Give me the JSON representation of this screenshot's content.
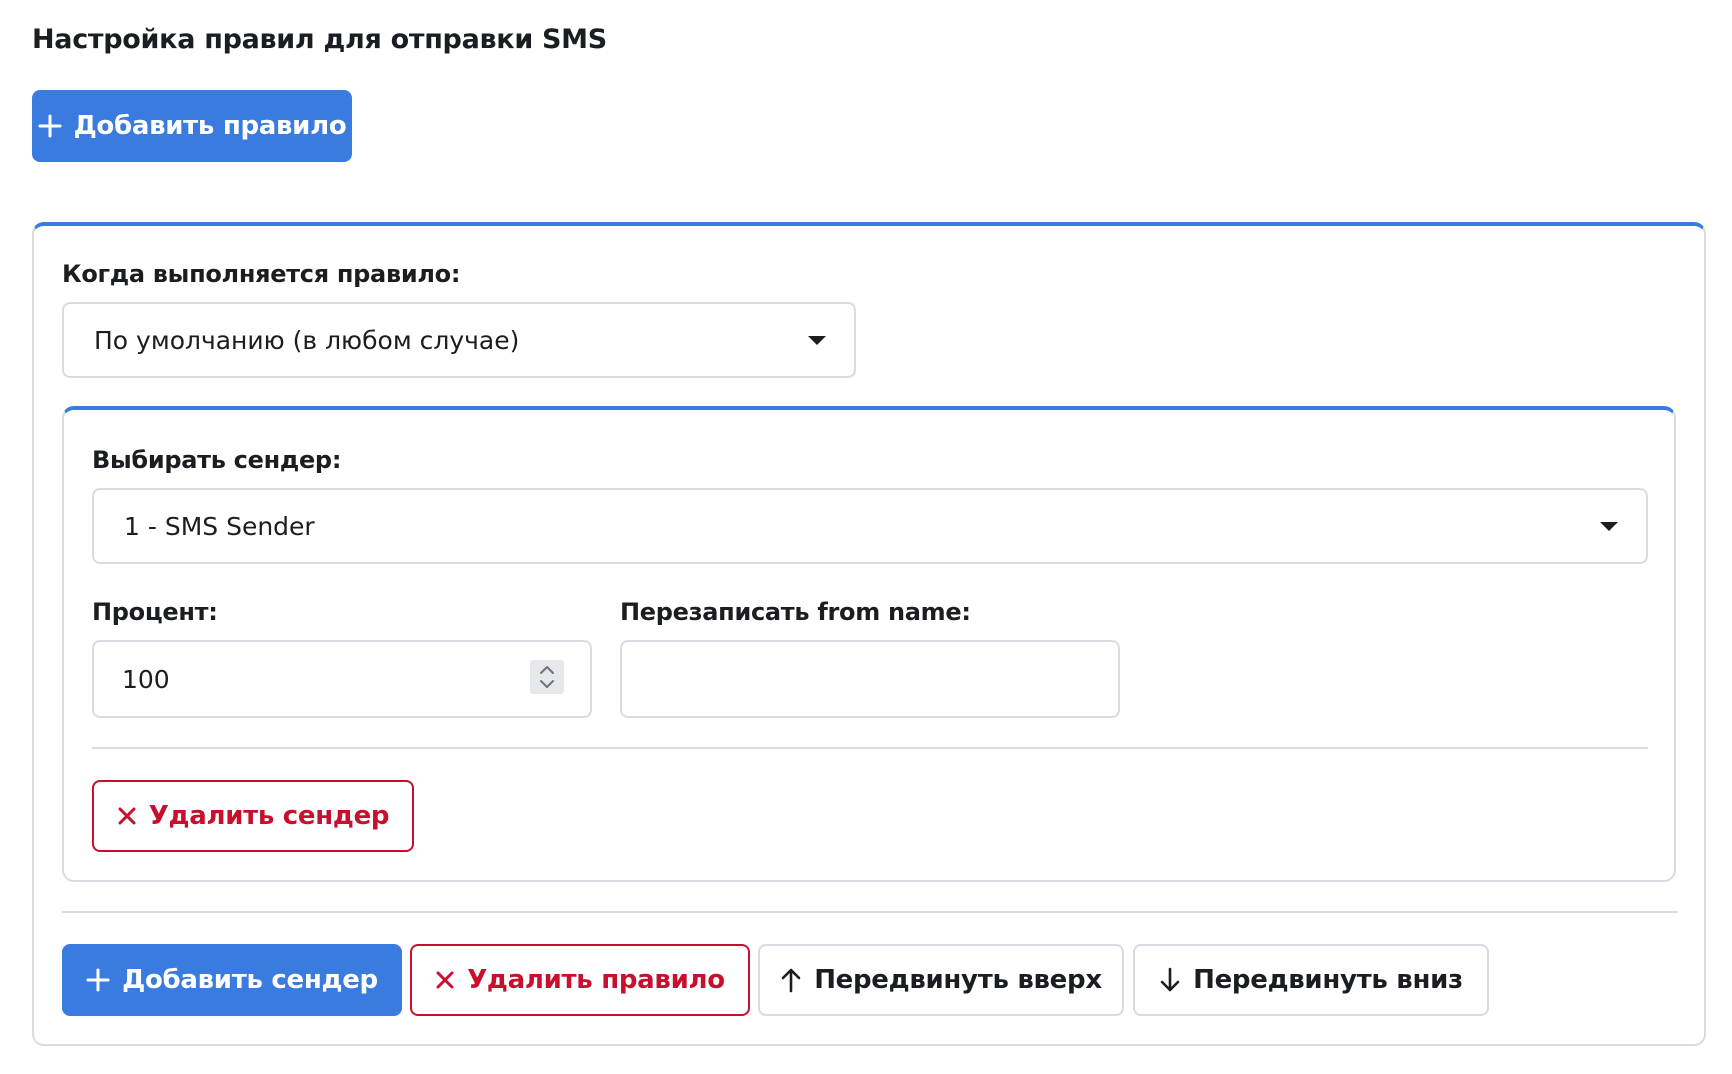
{
  "page": {
    "title": "Настройка правил для отправки SMS",
    "add_rule_label": "Добавить правило"
  },
  "rule": {
    "condition_label": "Когда выполняется правило:",
    "condition_value": "По умолчанию (в любом случае)",
    "sender_block": {
      "sender_label": "Выбирать сендер:",
      "sender_value": "1 - SMS Sender",
      "percent_label": "Процент:",
      "percent_value": "100",
      "from_name_label": "Перезаписать from name:",
      "from_name_value": "",
      "delete_sender_label": "Удалить сендер"
    },
    "actions": {
      "add_sender_label": "Добавить сендер",
      "delete_rule_label": "Удалить правило",
      "move_up_label": "Передвинуть вверх",
      "move_down_label": "Передвинуть вниз"
    }
  },
  "colors": {
    "primary": "#3a7be0",
    "danger": "#c8102e",
    "border": "#d8dbe0",
    "text": "#1a1d21"
  },
  "icons": {
    "add": "plus-icon",
    "delete": "close-icon",
    "move_up": "arrow-up-icon",
    "move_down": "arrow-down-icon",
    "select": "caret-down-icon",
    "spinner": "chevron-up-down-icon"
  }
}
